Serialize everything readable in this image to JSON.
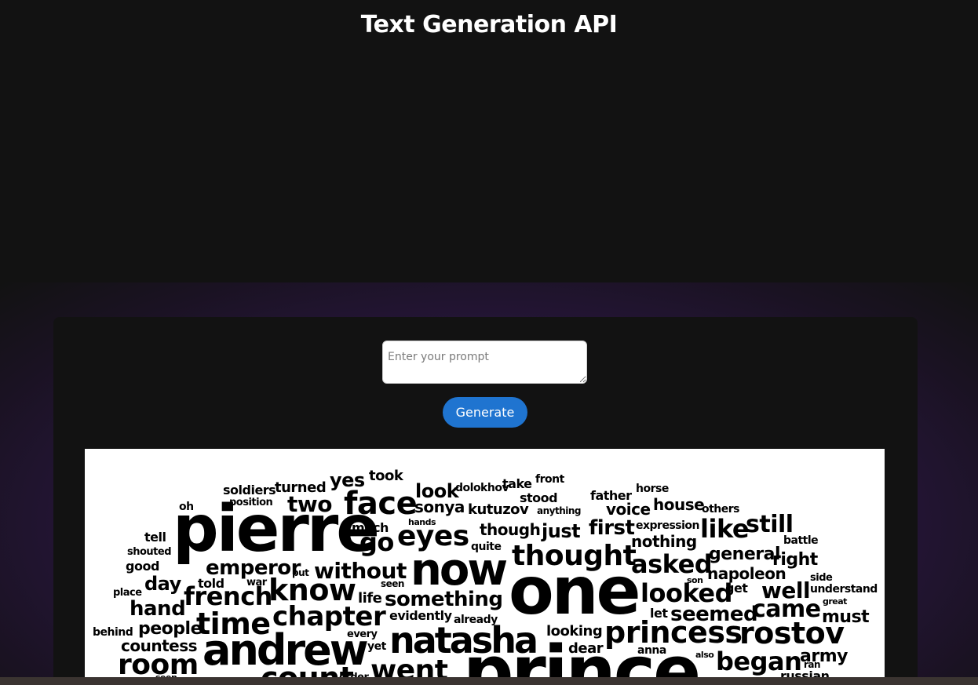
{
  "header": {
    "title": "Text Generation API"
  },
  "form": {
    "prompt_placeholder": "Enter your prompt",
    "prompt_value": "",
    "generate_label": "Generate"
  },
  "wordcloud": {
    "words": [
      {
        "text": "pierre"
      },
      {
        "text": "one"
      },
      {
        "text": "prince"
      },
      {
        "text": "now"
      },
      {
        "text": "andrew"
      },
      {
        "text": "natasha"
      },
      {
        "text": "princess"
      },
      {
        "text": "rostov"
      },
      {
        "text": "face"
      },
      {
        "text": "know"
      },
      {
        "text": "thought"
      },
      {
        "text": "eyes"
      },
      {
        "text": "time"
      },
      {
        "text": "chapter"
      },
      {
        "text": "french"
      },
      {
        "text": "room"
      },
      {
        "text": "count"
      },
      {
        "text": "went"
      },
      {
        "text": "looked"
      },
      {
        "text": "asked"
      },
      {
        "text": "came"
      },
      {
        "text": "began"
      },
      {
        "text": "well"
      },
      {
        "text": "like"
      },
      {
        "text": "still"
      },
      {
        "text": "emperor"
      },
      {
        "text": "something"
      },
      {
        "text": "without"
      },
      {
        "text": "go"
      },
      {
        "text": "two"
      },
      {
        "text": "seemed"
      },
      {
        "text": "just"
      },
      {
        "text": "first"
      },
      {
        "text": "general"
      },
      {
        "text": "napoleon"
      },
      {
        "text": "right"
      },
      {
        "text": "army"
      },
      {
        "text": "must"
      },
      {
        "text": "look"
      },
      {
        "text": "sonya"
      },
      {
        "text": "yes"
      },
      {
        "text": "hand"
      },
      {
        "text": "day"
      },
      {
        "text": "people"
      },
      {
        "text": "countess"
      },
      {
        "text": "nothing"
      },
      {
        "text": "voice"
      },
      {
        "text": "house"
      },
      {
        "text": "though"
      },
      {
        "text": "kutuzov"
      },
      {
        "text": "looking"
      },
      {
        "text": "dear"
      },
      {
        "text": "turned"
      },
      {
        "text": "soldiers"
      },
      {
        "text": "took"
      },
      {
        "text": "father"
      },
      {
        "text": "much"
      },
      {
        "text": "life"
      },
      {
        "text": "told"
      },
      {
        "text": "evidently"
      },
      {
        "text": "stood"
      },
      {
        "text": "take"
      },
      {
        "text": "dolokhov"
      },
      {
        "text": "front"
      },
      {
        "text": "horse"
      },
      {
        "text": "expression"
      },
      {
        "text": "others"
      },
      {
        "text": "battle"
      },
      {
        "text": "oh"
      },
      {
        "text": "tell"
      },
      {
        "text": "shouted"
      },
      {
        "text": "good"
      },
      {
        "text": "position"
      },
      {
        "text": "hands"
      },
      {
        "text": "anything"
      },
      {
        "text": "quite"
      },
      {
        "text": "place"
      },
      {
        "text": "war"
      },
      {
        "text": "put"
      },
      {
        "text": "seen"
      },
      {
        "text": "behind"
      },
      {
        "text": "every"
      },
      {
        "text": "yet"
      },
      {
        "text": "already"
      },
      {
        "text": "let"
      },
      {
        "text": "get"
      },
      {
        "text": "understand"
      },
      {
        "text": "side"
      },
      {
        "text": "son"
      },
      {
        "text": "great"
      },
      {
        "text": "anna"
      },
      {
        "text": "also"
      },
      {
        "text": "ran"
      },
      {
        "text": "russian"
      },
      {
        "text": "order"
      },
      {
        "text": "seen"
      }
    ]
  },
  "colors": {
    "background": "#121212",
    "accent": "#1f74d0",
    "glow": "#3a1d57"
  }
}
